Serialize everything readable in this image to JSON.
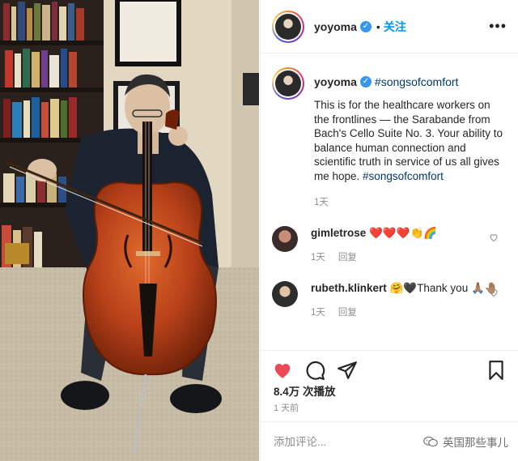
{
  "post": {
    "username": "yoyoma",
    "verified_mark": "✓",
    "separator": "•",
    "follow_label": "关注",
    "more_label": "•••"
  },
  "caption": {
    "username": "yoyoma",
    "hashtag": "#songsofcomfort",
    "text": "This is for the healthcare workers on the frontlines — the Sarabande from Bach's Cello Suite No. 3. Your ability to balance human connection and scientific truth in service of us all gives me hope. ",
    "text_tag": "#songsofcomfort",
    "time": "1天"
  },
  "comments": [
    {
      "username": "gimletrose",
      "text": "❤️❤️❤️👏🌈",
      "time": "1天",
      "reply_label": ""
    },
    {
      "username": "rubeth.klinkert",
      "text": "🤗🖤Thank you 🙏🏽🤚🏽",
      "time": "1天",
      "reply_label": "回复"
    }
  ],
  "comment0_reply": "回复",
  "stats": {
    "views": "8.4万 次播放",
    "time": "1 天前"
  },
  "add_comment": {
    "placeholder": "添加评论..."
  },
  "watermark": {
    "text": "英国那些事儿"
  },
  "icons": {
    "like": "heart-icon",
    "comment": "comment-icon",
    "share": "share-icon",
    "save": "bookmark-icon"
  },
  "colors": {
    "like_red": "#ed4956",
    "link_blue": "#00376b",
    "follow_blue": "#0095f6",
    "secondary_text": "#8e8e8e"
  }
}
